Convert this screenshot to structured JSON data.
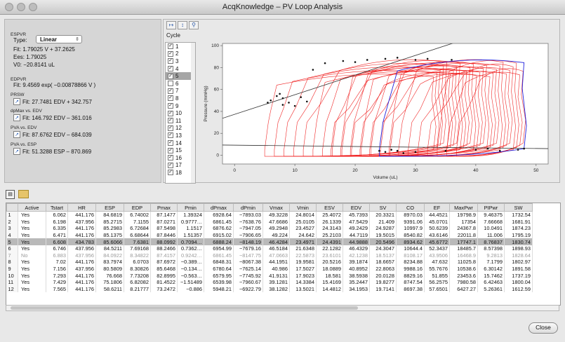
{
  "window": {
    "title": "AcqKnowledge – PV Loop Analysis"
  },
  "left": {
    "espvr": "ESPVR",
    "type_label": "Type:",
    "type_value": "Linear",
    "fit": "Fit:  1.79025 V + 37.2625",
    "ees": "Ees: 1.79025",
    "v0": "V0: −20.8141  uL",
    "edpvr": "EDPVR",
    "edpvr_fit": "Fit:  9.4569 exp( −0.00878866 V )",
    "prsw": "PRSW",
    "prsw_fit": "Fit:  27.7481 EDV + 342.757",
    "dpmax": "dpMax vs. EDV",
    "dpmax_fit": "Fit:  146.792 EDV – 361.016",
    "pva_edv": "PVA vs. EDV",
    "pva_edv_fit": "Fit:  87.6762 EDV – 684.039",
    "pva_esp": "PVA vs. ESP",
    "pva_esp_fit": "Fit:  51.3288 ESP – 870.869"
  },
  "cycle": {
    "header": "Cycle",
    "items": [
      {
        "n": "1",
        "checked": true
      },
      {
        "n": "2",
        "checked": true
      },
      {
        "n": "3",
        "checked": true
      },
      {
        "n": "4",
        "checked": true
      },
      {
        "n": "5",
        "checked": true,
        "selected": true
      },
      {
        "n": "6",
        "checked": false
      },
      {
        "n": "7",
        "checked": true
      },
      {
        "n": "8",
        "checked": true
      },
      {
        "n": "9",
        "checked": true
      },
      {
        "n": "10",
        "checked": true
      },
      {
        "n": "11",
        "checked": true
      },
      {
        "n": "12",
        "checked": true
      },
      {
        "n": "13",
        "checked": true
      },
      {
        "n": "14",
        "checked": true
      },
      {
        "n": "15",
        "checked": true
      },
      {
        "n": "16",
        "checked": true
      },
      {
        "n": "17",
        "checked": true
      },
      {
        "n": "18",
        "checked": true
      }
    ]
  },
  "chart_data": {
    "type": "line",
    "xlabel": "Volume (uL)",
    "ylabel": "Pressure (mmHg)",
    "xticks": [
      0,
      10,
      20,
      30,
      40,
      50
    ],
    "yticks": [
      0,
      20,
      40,
      60,
      80,
      100
    ],
    "xlim": [
      -2,
      52
    ],
    "ylim": [
      -8,
      102
    ],
    "loop_color": "#ee1111",
    "selected_color": "#2222dd",
    "line_color": "#333333",
    "espvr_line": [
      [
        -2,
        33.7
      ],
      [
        40,
        109
      ]
    ],
    "edpvr_line": [
      [
        -2,
        9.3
      ],
      [
        56,
        5.8
      ]
    ]
  },
  "table": {
    "columns": [
      "",
      "Active",
      "Tstart",
      "HR",
      "ESP",
      "EDP",
      "Pmax",
      "Pmin",
      "dPmax",
      "dPmin",
      "Vmax",
      "Vmin",
      "ESV",
      "EDV",
      "SV",
      "CO",
      "EF",
      "MaxPwr",
      "PIPwr",
      "SW"
    ],
    "rows": [
      [
        "1",
        "Yes",
        "6.062",
        "441.176",
        "84.6819",
        "6.74002",
        "87.1477",
        "1.39324",
        "6928.64",
        "−7893.03",
        "49.3228",
        "24.8014",
        "25.4072",
        "45.7393",
        "20.3321",
        "8970.03",
        "44.4521",
        "19798.9",
        "9.46375",
        "1732.54"
      ],
      [
        "2",
        "Yes",
        "6.198",
        "437.956",
        "85.2715",
        "7.1155",
        "87.0271",
        "0.9777…",
        "6861.45",
        "−7638.76",
        "47.6686",
        "25.0105",
        "26.1339",
        "47.5429",
        "21.409",
        "9391.06",
        "45.0701",
        "17354",
        "7.66668",
        "1681.91"
      ],
      [
        "3",
        "Yes",
        "6.335",
        "441.176",
        "85.2983",
        "6.72684",
        "87.5498",
        "1.1517",
        "6876.62",
        "−7947.05",
        "49.2948",
        "23.4527",
        "24.3143",
        "49.2429",
        "24.9287",
        "10997.9",
        "50.6239",
        "24367.8",
        "10.0491",
        "1874.23"
      ],
      [
        "4",
        "Yes",
        "6.471",
        "441.176",
        "85.1375",
        "6.68644",
        "87.8446",
        "1.51357",
        "6915.02",
        "−7906.65",
        "49.224",
        "24.642",
        "25.2103",
        "44.7119",
        "19.5015",
        "8540.82",
        "43.6146",
        "22011.8",
        "11.006",
        "1795.19"
      ],
      [
        "5",
        "Yes",
        "6.608",
        "434.783",
        "85.6066",
        "7.6381",
        "88.0992",
        "0.7094…",
        "6888.24",
        "−8148.19",
        "46.4284",
        "23.4971",
        "24.4391",
        "44.9888",
        "20.5496",
        "8934.62",
        "45.6772",
        "17747.1",
        "8.76837",
        "1830.74"
      ],
      [
        "6",
        "Yes",
        "6.746",
        "437.956",
        "84.5211",
        "7.69168",
        "88.2466",
        "0.7362…",
        "6954.99",
        "−7679.16",
        "46.5184",
        "21.6348",
        "22.1282",
        "46.4329",
        "24.3047",
        "10644.4",
        "52.3437",
        "18485.7",
        "8.57398",
        "1898.93"
      ],
      [
        "7",
        "No",
        "6.883",
        "437.956",
        "84.0922",
        "8.34822",
        "87.4157",
        "0.9242…",
        "6861.45",
        "−8147.75",
        "47.0663",
        "22.5873",
        "23.6101",
        "42.1238",
        "18.5137",
        "8108.17",
        "43.9506",
        "16468.9",
        "9.2813",
        "1828.64"
      ],
      [
        "8",
        "Yes",
        "7.02",
        "441.176",
        "83.7974",
        "6.0703",
        "87.6972",
        "−0.389…",
        "6848.31",
        "−8067.38",
        "44.1951",
        "19.9581",
        "20.5216",
        "39.1874",
        "18.6657",
        "8234.88",
        "47.632",
        "11025.8",
        "7.1799",
        "1802.97"
      ],
      [
        "9",
        "Yes",
        "7.156",
        "437.956",
        "80.5809",
        "8.30826",
        "85.6468",
        "−0.134…",
        "6780.64",
        "−7625.14",
        "40.986",
        "17.5027",
        "18.0889",
        "40.8952",
        "22.8063",
        "9988.16",
        "55.7676",
        "10538.6",
        "6.30142",
        "1891.58"
      ],
      [
        "10",
        "Yes",
        "7.293",
        "441.176",
        "76.668",
        "7.73208",
        "82.8995",
        "−0.563…",
        "6579.95",
        "−7745.92",
        "41.9131",
        "17.9023",
        "18.581",
        "38.5938",
        "20.0128",
        "8829.16",
        "51.855",
        "23453.6",
        "15.7462",
        "1737.19"
      ],
      [
        "11",
        "Yes",
        "7.429",
        "441.176",
        "75.1806",
        "6.82082",
        "81.4522",
        "−1.51489",
        "6539.98",
        "−7960.67",
        "39.1281",
        "14.3384",
        "15.4169",
        "35.2447",
        "19.8277",
        "8747.54",
        "56.2575",
        "7980.58",
        "6.42463",
        "1800.04"
      ],
      [
        "12",
        "Yes",
        "7.565",
        "441.176",
        "58.6211",
        "8.21777",
        "73.2472",
        "−0.886",
        "5948.21",
        "−6922.79",
        "38.1282",
        "13.5021",
        "14.4812",
        "34.1953",
        "19.7141",
        "8697.38",
        "57.6501",
        "6427.27",
        "5.26361",
        "1612.59"
      ]
    ]
  },
  "toolbar": {
    "close_label": "Close"
  }
}
